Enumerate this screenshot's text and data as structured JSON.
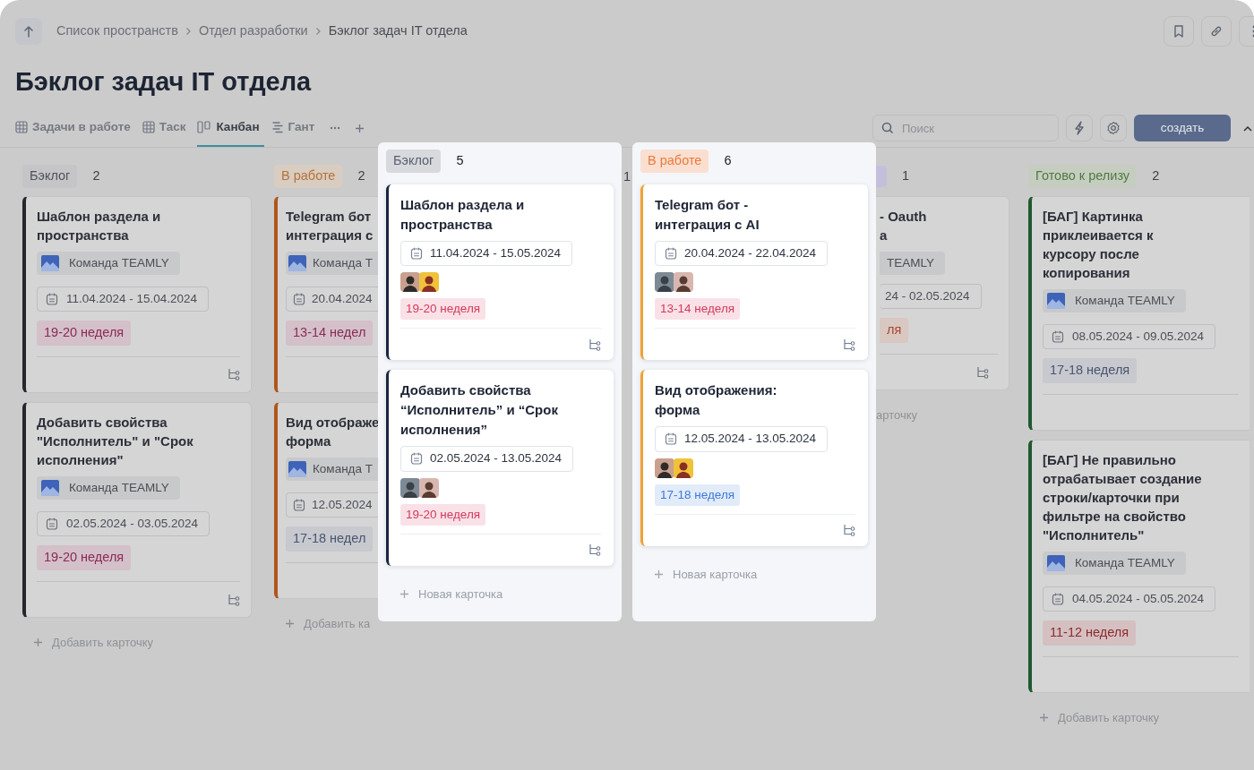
{
  "breadcrumbs": [
    "Список пространств",
    "Отдел разработки",
    "Бэклог задач IT отдела"
  ],
  "title": "Бэклог задач IT отдела",
  "view_tabs": [
    {
      "label": "Задачи в работе",
      "kind": "table",
      "selected": false
    },
    {
      "label": "Таск",
      "kind": "table",
      "selected": false
    },
    {
      "label": "Канбан",
      "kind": "kanban",
      "selected": true
    },
    {
      "label": "Гант",
      "kind": "gantt",
      "selected": false
    }
  ],
  "search": {
    "placeholder": "Поиск"
  },
  "create_button": "создать",
  "columns": [
    {
      "kind": "full",
      "label": "Бэклог",
      "color": "#4f535a",
      "count": "2",
      "add_label": "Добавить карточку",
      "cards": [
        {
          "title": "Шаблон раздела и пространства",
          "color": "#26272b",
          "team": "Команда TEAMLY",
          "dates": "11.04.2024 - 15.04.2024",
          "week": {
            "label": "19-20 неделя",
            "color": "#8a2a57"
          }
        },
        {
          "title": "Добавить свойства \"Исполнитель\" и \"Срок исполнения\"",
          "color": "#26272b",
          "team": "Команда TEAMLY",
          "dates": "02.05.2024 - 03.05.2024",
          "week": {
            "label": "19-20 неделя",
            "color": "#8a2a57"
          }
        }
      ]
    },
    {
      "kind": "clip_right",
      "label": "В работе",
      "color": "#b5733a",
      "count": "2",
      "add_label": "Добавить ка",
      "cards": [
        {
          "title_lines": [
            "Telegram бот",
            "интеграция с"
          ],
          "color": "#b0561a",
          "team": "Команда T",
          "dates": "20.04.2024",
          "week": {
            "label": "13-14 недел",
            "color": "#8a2a57"
          }
        },
        {
          "title_lines": [
            "Вид отображе",
            "форма"
          ],
          "color": "#b0561a",
          "team": "Команда T",
          "dates": "12.05.2024",
          "week": {
            "label": "17-18 недел",
            "color": "#4a5570"
          }
        }
      ]
    },
    {
      "kind": "popup",
      "label": "Бэклог",
      "color": "#5a6270",
      "count": "5",
      "add_label": "Новая карточка",
      "cards": [
        {
          "title": "Шаблон раздела и пространства",
          "color": "#1b2640",
          "dates": "11.04.2024 - 15.05.2024",
          "week": {
            "label": "19-20 неделя",
            "color": "#d43a5c"
          }
        },
        {
          "title": "Добавить свойства “Исполнитель” и “Срок исполнения”",
          "color": "#1b2640",
          "dates": "02.05.2024 - 13.05.2024",
          "week": {
            "label": "19-20 неделя",
            "color": "#d43a5c"
          }
        }
      ]
    },
    {
      "kind": "sliver",
      "count": "1"
    },
    {
      "kind": "popup",
      "label": "В работе",
      "color": "#ea7a3c",
      "count": "6",
      "add_label": "Новая карточка",
      "cards": [
        {
          "title": "Telegram бот - интеграция с AI",
          "color": "#f0a232",
          "dates": "20.04.2024 - 22.04.2024",
          "week": {
            "label": "13-14 неделя",
            "color": "#d43a5c"
          }
        },
        {
          "title": "Вид отображения: форма",
          "color": "#f0a232",
          "dates": "12.05.2024 - 13.05.2024",
          "week": {
            "label": "17-18 неделя",
            "color": "#3b7bd8"
          }
        }
      ]
    },
    {
      "kind": "clip_left",
      "color": "#c6bfdc",
      "count": "1",
      "add_label": "арточку",
      "cards": [
        {
          "title_lines": [
            "- Oauth",
            "а"
          ],
          "team": "TEAMLY",
          "dates": "24 - 02.05.2024",
          "week": {
            "label": "ля",
            "color": "#a64a2c"
          }
        }
      ]
    },
    {
      "kind": "edge",
      "label": "Готово к релизу",
      "color": "#4f7a3e",
      "count": "2",
      "add_label": "Добавить карточку",
      "cards": [
        {
          "title": "[БАГ] Картинка приклеивается к курсору после копирования",
          "color": "#1f5a2f",
          "team": "Команда TEAMLY",
          "dates": "08.05.2024 - 09.05.2024",
          "week": {
            "label": "17-18 неделя",
            "color": "#4a5570"
          }
        },
        {
          "title": "[БАГ] Не правильно отрабатывает создание строки/карточки при фильтре на свойство \"Исполнитель\"",
          "color": "#1f5a2f",
          "team": "Команда TEAMLY",
          "dates": "04.05.2024 - 05.05.2024",
          "week": {
            "label": "11-12 неделя",
            "color": "#8e2a2e"
          }
        }
      ]
    }
  ]
}
